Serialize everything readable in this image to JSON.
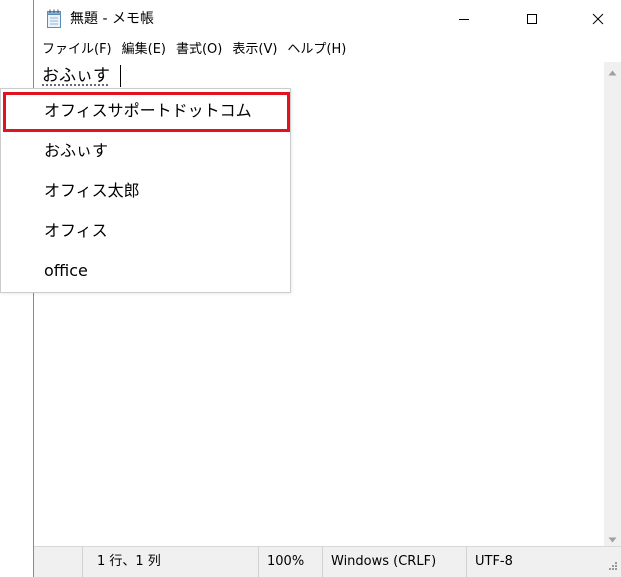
{
  "window": {
    "title": "無題 - メモ帳",
    "icon": "notepad-icon",
    "controls": [
      "minimize-icon",
      "maximize-icon",
      "close-icon"
    ]
  },
  "menu": {
    "items": [
      "ファイル(F)",
      "編集(E)",
      "書式(O)",
      "表示(V)",
      "ヘルプ(H)"
    ]
  },
  "editor": {
    "text": "おふぃす"
  },
  "ime_candidates": {
    "items": [
      "オフィスサポートドットコム",
      "おふぃす",
      "オフィス太郎",
      "オフィス",
      "office"
    ],
    "highlight_color": "#e0141e"
  },
  "status": {
    "position": "1 行、1 列",
    "zoom": "100%",
    "line_ending": "Windows (CRLF)",
    "encoding": "UTF-8"
  }
}
